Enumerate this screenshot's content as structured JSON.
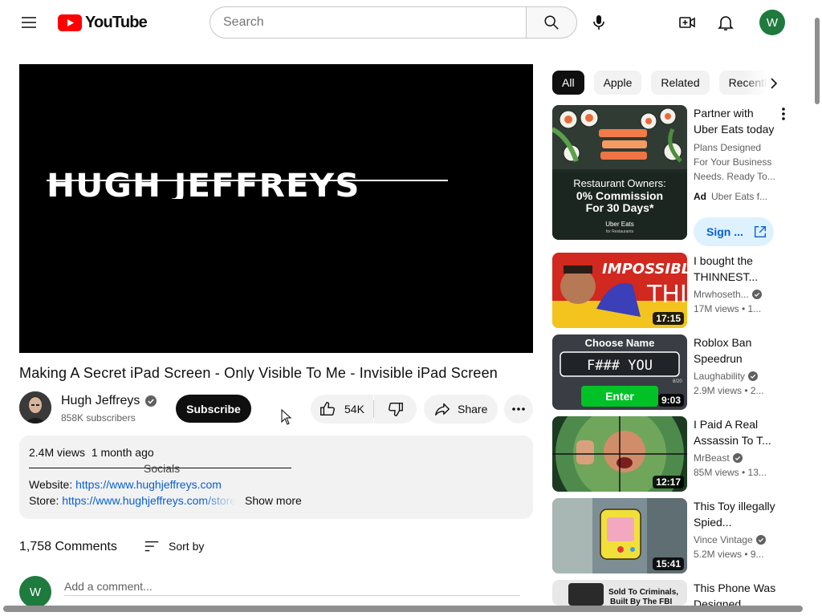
{
  "header": {
    "logo_text": "YouTube",
    "search_placeholder": "Search",
    "account_initial": "W"
  },
  "player": {
    "overlay_text": "HUGH JEFFREYS"
  },
  "video": {
    "title": "Making A Secret iPad Screen - Only Visible To Me - Invisible iPad Screen",
    "channel_name": "Hugh Jeffreys",
    "subscribers": "858K subscribers",
    "subscribe_label": "Subscribe",
    "likes": "54K",
    "share_label": "Share"
  },
  "description": {
    "views": "2.4M views",
    "age": "1 month ago",
    "socials_heading": "Socials",
    "website_label": "Website: ",
    "website_url": "https://www.hughjeffreys.com",
    "store_label": "Store: ",
    "store_url": "https://www.hughjeffreys.com/store",
    "show_more": "Show more"
  },
  "comments": {
    "count": "1,758 Comments",
    "sort_label": "Sort by",
    "user_initial": "W",
    "placeholder": "Add a comment..."
  },
  "chips": [
    "All",
    "Apple",
    "Related",
    "Recently uploaded"
  ],
  "ad": {
    "title": "Partner with Uber Eats today",
    "description": "Plans Designed For Your Business Needs. Ready To...",
    "ad_badge": "Ad",
    "advertiser": "Uber Eats f...",
    "button_label": "Sign ...",
    "thumb_headline": "Restaurant Owners: 0% Commission For 30 Days*",
    "thumb_brand": "Uber Eats",
    "thumb_brand_sub": "for Restaurants"
  },
  "recommendations": [
    {
      "title": "I bought the THINNEST...",
      "channel": "Mrwhoseth...",
      "verified": true,
      "meta": "17M views • 1...",
      "duration": "17:15",
      "thumb_text": "IMPOSSIBLY THIN"
    },
    {
      "title": "Roblox Ban Speedrun",
      "channel": "Laughability",
      "verified": true,
      "meta": "2.9M views • 2...",
      "duration": "9:03",
      "thumb_text": "Choose Name",
      "thumb_field": "F### YOU",
      "thumb_button": "Enter",
      "thumb_counter": "8/20"
    },
    {
      "title": "I Paid A Real Assassin To T...",
      "channel": "MrBeast",
      "verified": true,
      "meta": "85M views • 13...",
      "duration": "12:17"
    },
    {
      "title": "This Toy illegally Spied...",
      "channel": "Vince Vintage",
      "verified": true,
      "meta": "5.2M views • 9...",
      "duration": "15:41"
    },
    {
      "title": "This Phone Was Designed...",
      "channel": "",
      "verified": false,
      "meta": "",
      "duration": "",
      "thumb_text": "Sold To Criminals, Built By The FBI"
    }
  ],
  "colors": {
    "brand_red": "#ff0000",
    "link_blue": "#065fd4",
    "subscribe_bg": "#0f0f0f",
    "account_green": "#1e7a3d",
    "panel_gray": "#f2f2f2"
  }
}
